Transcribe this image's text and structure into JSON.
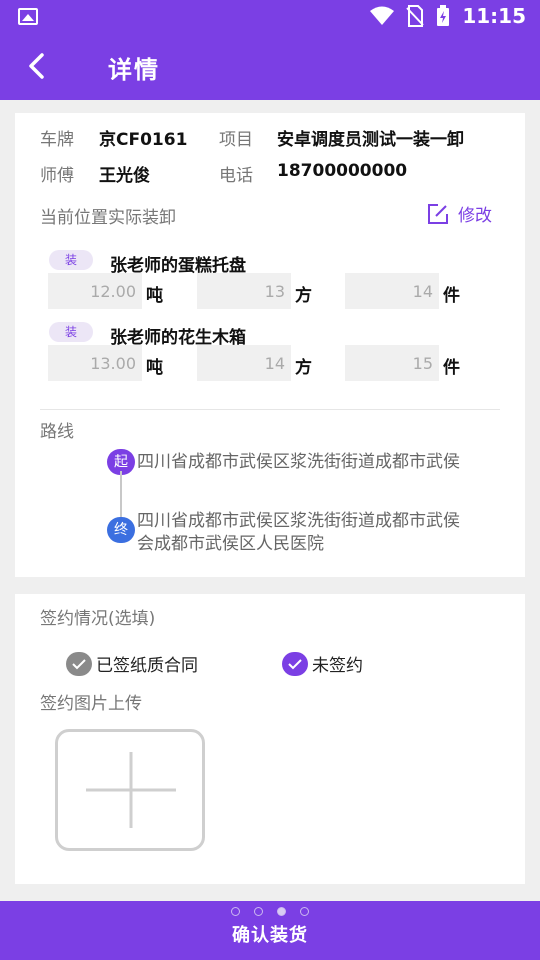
{
  "status_bar": {
    "time": "11:15",
    "icons": [
      "image-icon",
      "wifi-icon",
      "no-sim-icon",
      "battery-charging-icon"
    ]
  },
  "header": {
    "title": "详情"
  },
  "vehicle": {
    "plate_label": "车牌",
    "plate_value": "京CF0161",
    "project_label": "项目",
    "project_value": "安卓调度员测试一装一卸",
    "driver_label": "师傅",
    "driver_value": "王光俊",
    "phone_label": "电话",
    "phone_value": "18700000000"
  },
  "loading": {
    "title": "当前位置实际装卸",
    "edit_label": "修改",
    "items": [
      {
        "tag": "装",
        "name": "张老师的蛋糕托盘",
        "weight": "12.00",
        "weight_unit": "吨",
        "volume": "13",
        "volume_unit": "方",
        "count": "14",
        "count_unit": "件"
      },
      {
        "tag": "装",
        "name": "张老师的花生木箱",
        "weight": "13.00",
        "weight_unit": "吨",
        "volume": "14",
        "volume_unit": "方",
        "count": "15",
        "count_unit": "件"
      }
    ]
  },
  "route": {
    "title": "路线",
    "start_tag": "起",
    "start_line": "四川省成都市武侯区浆洗街街道成都市武侯",
    "end_tag": "终",
    "end_line1": "四川省成都市武侯区浆洗街街道成都市武侯",
    "end_line2": "会成都市武侯区人民医院"
  },
  "signing": {
    "title": "签约情况(选填)",
    "option_signed": "已签纸质合同",
    "option_unsigned": "未签约",
    "upload_title": "签约图片上传"
  },
  "footer": {
    "confirm_label": "确认装货",
    "pager_total": 4,
    "pager_active": 3
  },
  "colors": {
    "brand": "#7b3fe4",
    "route_end": "#3b6fe0"
  }
}
